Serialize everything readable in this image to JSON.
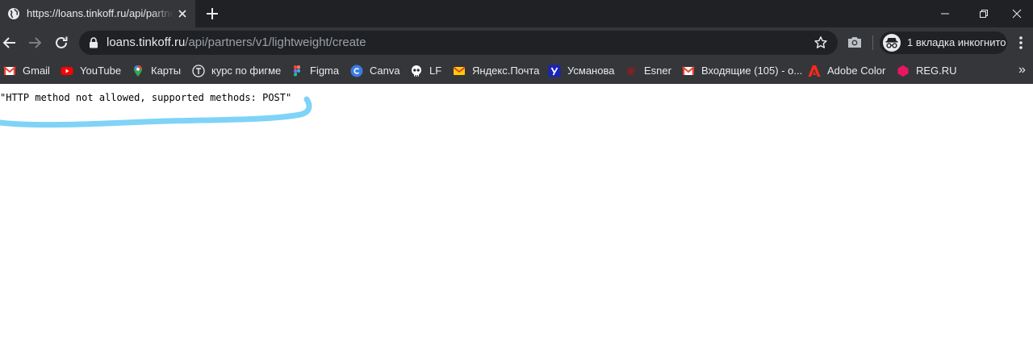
{
  "tab": {
    "title": "https://loans.tinkoff.ru/api/partners/v1/lightweight/create",
    "favicon": "globe-icon"
  },
  "address_bar": {
    "host": "loans.tinkoff.ru",
    "path": "/api/partners/v1/lightweight/create"
  },
  "incognito": {
    "label": "1 вкладка инкогнито"
  },
  "bookmarks": [
    {
      "label": "Gmail",
      "icon": "gmail-icon"
    },
    {
      "label": "YouTube",
      "icon": "youtube-icon"
    },
    {
      "label": "Карты",
      "icon": "maps-pin-icon"
    },
    {
      "label": "курс по фигме",
      "icon": "t-circle-icon"
    },
    {
      "label": "Figma",
      "icon": "figma-icon"
    },
    {
      "label": "Canva",
      "icon": "canva-icon"
    },
    {
      "label": "LF",
      "icon": "skull-icon"
    },
    {
      "label": "Яндекс.Почта",
      "icon": "envelope-icon"
    },
    {
      "label": "Усманова",
      "icon": "u-letter-icon"
    },
    {
      "label": "Esner",
      "icon": "splash-icon"
    },
    {
      "label": "Входящие (105) - о...",
      "icon": "gmail-icon"
    },
    {
      "label": "Adobe Color",
      "icon": "adobe-icon"
    },
    {
      "label": "REG.RU",
      "icon": "hexagon-icon"
    }
  ],
  "bookmarks_overflow": "»",
  "page": {
    "response_text": "\"HTTP method not allowed, supported methods: POST\""
  },
  "colors": {
    "tab_strip": "#202124",
    "toolbar": "#35363a",
    "omnibox": "#202124",
    "highlight_stroke": "#7fd3f7"
  }
}
